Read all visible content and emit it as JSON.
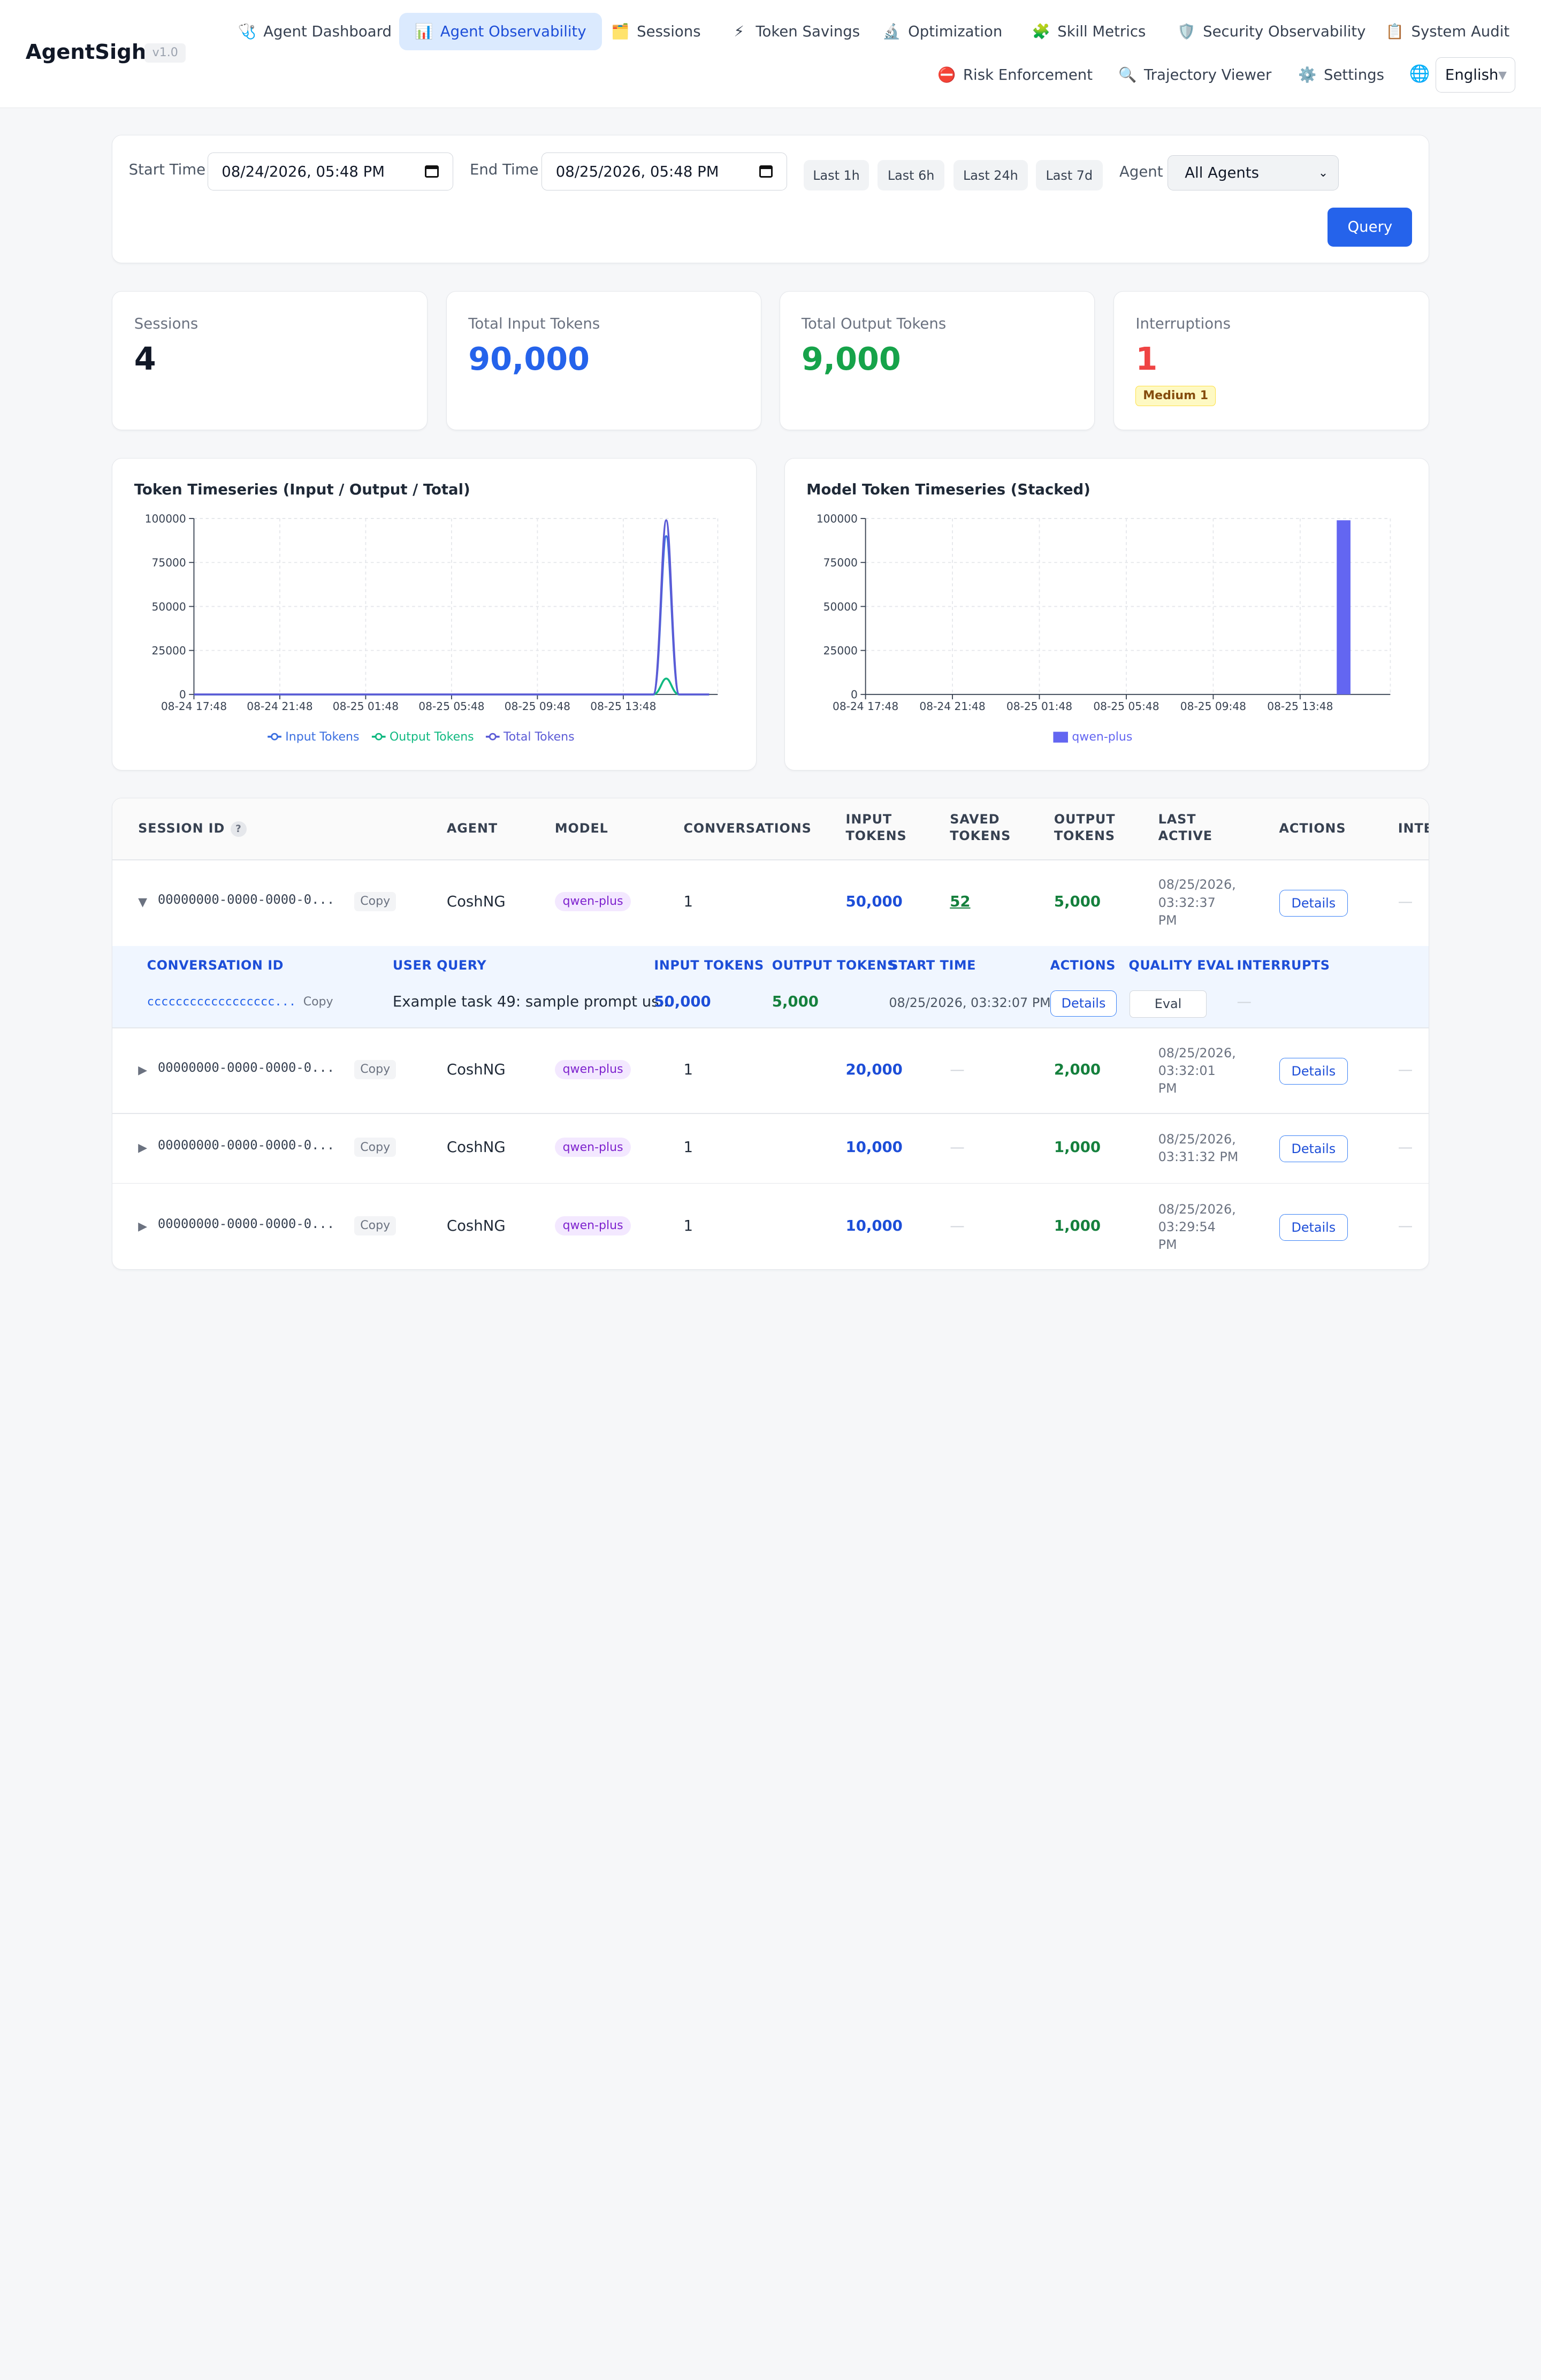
{
  "app": {
    "brand": "AgentSight",
    "version": "v1.0"
  },
  "nav": [
    {
      "label": "Agent Dashboard",
      "icon": "🩺"
    },
    {
      "label": "Agent Observability",
      "icon": "📊",
      "active": true
    },
    {
      "label": "Sessions",
      "icon": "🗂️"
    },
    {
      "label": "Token Savings",
      "icon": "⚡"
    },
    {
      "label": "Optimization",
      "icon": "🔬"
    },
    {
      "label": "Skill Metrics",
      "icon": "🧩"
    },
    {
      "label": "Security Observability",
      "icon": "🛡️"
    },
    {
      "label": "System Audit",
      "icon": "📋"
    },
    {
      "label": "Risk Enforcement",
      "icon": "⛔"
    },
    {
      "label": "Trajectory Viewer",
      "icon": "🔍"
    },
    {
      "label": "Settings",
      "icon": "⚙️"
    }
  ],
  "language": {
    "icon": "🌐",
    "selected": "English"
  },
  "filters": {
    "start_label": "Start Time",
    "start_value": "08/24/2026, 05:48 PM",
    "end_label": "End Time",
    "end_value": "08/25/2026, 05:48 PM",
    "quick": [
      "Last 1h",
      "Last 6h",
      "Last 24h",
      "Last 7d"
    ],
    "agent_label": "Agent",
    "agent_value": "All Agents",
    "query_label": "Query"
  },
  "stats": {
    "sessions": {
      "label": "Sessions",
      "value": "4"
    },
    "input_tokens": {
      "label": "Total Input Tokens",
      "value": "90,000"
    },
    "output_tokens": {
      "label": "Total Output Tokens",
      "value": "9,000"
    },
    "interruptions": {
      "label": "Interruptions",
      "value": "1",
      "badge": "Medium 1"
    }
  },
  "colors": {
    "accent": "#2563eb",
    "input": "#3b6fe0",
    "output": "#10b981",
    "total": "#5b5bd6",
    "bar": "#6366f1"
  },
  "chart_data": [
    {
      "type": "line",
      "title": "Token Timeseries (Input / Output / Total)",
      "x_ticks": [
        "08-24 17:48",
        "08-24 21:48",
        "08-25 01:48",
        "08-25 05:48",
        "08-25 09:48",
        "08-25 13:48"
      ],
      "y_ticks": [
        "0",
        "25000",
        "50000",
        "75000",
        "100000"
      ],
      "ylim": [
        0,
        100000
      ],
      "x_range_hours": [
        0,
        24
      ],
      "series": [
        {
          "name": "Input Tokens",
          "points": [
            [
              0,
              0
            ],
            [
              21.4,
              0
            ],
            [
              22.0,
              90000
            ],
            [
              22.6,
              0
            ],
            [
              24,
              0
            ]
          ]
        },
        {
          "name": "Output Tokens",
          "points": [
            [
              0,
              0
            ],
            [
              21.4,
              0
            ],
            [
              22.0,
              9000
            ],
            [
              22.6,
              0
            ],
            [
              24,
              0
            ]
          ]
        },
        {
          "name": "Total Tokens",
          "points": [
            [
              0,
              0
            ],
            [
              21.4,
              0
            ],
            [
              22.0,
              99000
            ],
            [
              22.6,
              0
            ],
            [
              24,
              0
            ]
          ]
        }
      ],
      "legend": "bottom",
      "grid": true
    },
    {
      "type": "bar",
      "title": "Model Token Timeseries (Stacked)",
      "x_ticks": [
        "08-24 17:48",
        "08-24 21:48",
        "08-25 01:48",
        "08-25 05:48",
        "08-25 09:48",
        "08-25 13:48"
      ],
      "y_ticks": [
        "0",
        "25000",
        "50000",
        "75000",
        "100000"
      ],
      "ylim": [
        0,
        100000
      ],
      "x_range_hours": [
        0,
        24
      ],
      "series": [
        {
          "name": "qwen-plus",
          "bars": [
            {
              "hour": 22.0,
              "value": 99000
            }
          ]
        }
      ],
      "legend": "bottom",
      "grid": true
    }
  ],
  "table": {
    "headers": [
      "SESSION ID",
      "AGENT",
      "MODEL",
      "CONVERSATIONS",
      "INPUT TOKENS",
      "SAVED TOKENS",
      "OUTPUT TOKENS",
      "LAST ACTIVE",
      "ACTIONS",
      "INTE"
    ],
    "copy_label": "Copy",
    "details_label": "Details",
    "rows": [
      {
        "expanded": true,
        "expander": "▼",
        "session_id": "00000000-0000-0000-0...",
        "agent": "CoshNG",
        "model": "qwen-plus",
        "conversations": "1",
        "input": "50,000",
        "saved": "52",
        "output": "5,000",
        "last_active": [
          "08/25/2026,",
          "03:32:37",
          "PM"
        ],
        "interrupts": "—"
      },
      {
        "expanded": false,
        "expander": "▶",
        "session_id": "00000000-0000-0000-0...",
        "agent": "CoshNG",
        "model": "qwen-plus",
        "conversations": "1",
        "input": "20,000",
        "saved": "—",
        "output": "2,000",
        "last_active": [
          "08/25/2026,",
          "03:32:01",
          "PM"
        ],
        "interrupts": "—"
      },
      {
        "expanded": false,
        "expander": "▶",
        "session_id": "00000000-0000-0000-0...",
        "agent": "CoshNG",
        "model": "qwen-plus",
        "conversations": "1",
        "input": "10,000",
        "saved": "—",
        "output": "1,000",
        "last_active": [
          "08/25/2026,",
          "03:31:32 PM"
        ],
        "interrupts": "—"
      },
      {
        "expanded": false,
        "expander": "▶",
        "session_id": "00000000-0000-0000-0...",
        "agent": "CoshNG",
        "model": "qwen-plus",
        "conversations": "1",
        "input": "10,000",
        "saved": "—",
        "output": "1,000",
        "last_active": [
          "08/25/2026,",
          "03:29:54",
          "PM"
        ],
        "interrupts": "—"
      }
    ],
    "conversation": {
      "headers": [
        "CONVERSATION ID",
        "USER QUERY",
        "INPUT TOKENS",
        "OUTPUT TOKENS",
        "START TIME",
        "ACTIONS",
        "QUALITY EVAL",
        "INTERRUPTS"
      ],
      "conversation_id": "cccccccccccccccccc...",
      "user_query": "Example task 49: sample prompt us...",
      "input": "50,000",
      "output": "5,000",
      "start_time": "08/25/2026, 03:32:07 PM",
      "eval_label": "Eval",
      "interrupts": "—"
    }
  }
}
